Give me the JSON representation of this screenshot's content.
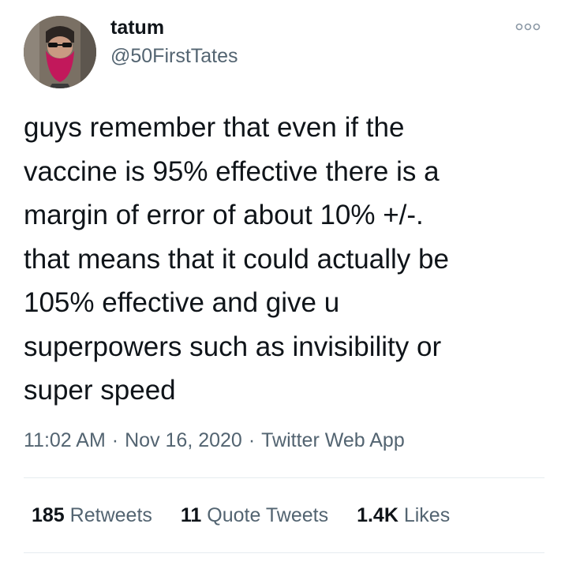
{
  "user": {
    "display_name": "tatum",
    "handle": "@50FirstTates"
  },
  "more_icon": "more-options-icon",
  "tweet": {
    "text": "guys remember that even if the\nvaccine is 95% effective there is a\nmargin of error of about 10% +/-.\nthat means that it could actually be\n105% effective and give u\nsuperpowers such as invisibility or\nsuper speed"
  },
  "meta": {
    "time": "11:02 AM",
    "separator": "·",
    "date": "Nov 16, 2020",
    "source": "Twitter Web App"
  },
  "stats": {
    "retweets_count": "185",
    "retweets_label": "Retweets",
    "quotes_count": "11",
    "quotes_label": "Quote Tweets",
    "likes_count": "1.4K",
    "likes_label": "Likes"
  }
}
